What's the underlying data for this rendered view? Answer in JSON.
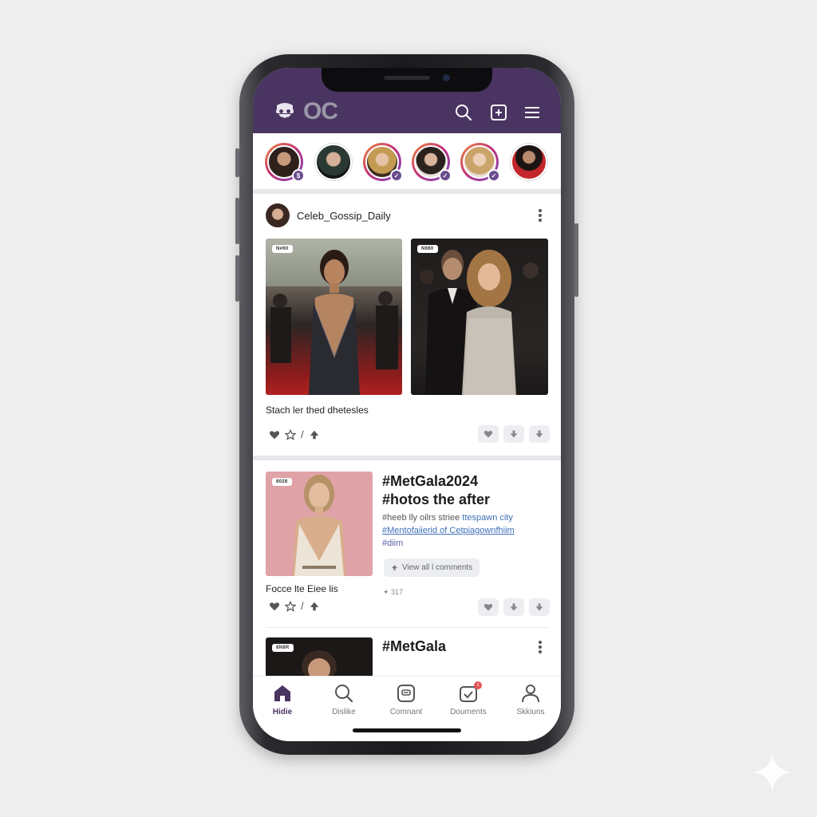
{
  "app": {
    "logo_text": "OC",
    "header_icons": [
      "search-icon",
      "add-post-icon",
      "menu-icon"
    ]
  },
  "stories": [
    {
      "badge": "$"
    },
    {
      "badge": ""
    },
    {
      "badge": "✓"
    },
    {
      "badge": "✓"
    },
    {
      "badge": "✓"
    },
    {
      "badge": ""
    }
  ],
  "post1": {
    "username": "Celeb_Gossip_Daily",
    "photo_tags": [
      "N#60",
      "N860"
    ],
    "caption": "Stach ler thed dhetesles",
    "react_separator": "/"
  },
  "post2": {
    "photo_tag": "8028",
    "headline_line1": "#MetGala2024",
    "headline_line2": "#hotos the after",
    "body_line1_plain": "#heeb lly oilrs striee ",
    "body_line1_link": "ttespawn city",
    "body_line2_link": "#Mentofaiierid of Cetpiagownfhiim",
    "body_line3_hash": "#diim",
    "comments_label": "View all l comments",
    "caption": "Focce lte Eiee lis",
    "meta": "317",
    "react_separator": "/"
  },
  "post3": {
    "photo_tag": "8N8R",
    "headline": "#MetGala"
  },
  "bottom_nav": [
    {
      "label": "Hidie",
      "icon": "home-icon",
      "active": true
    },
    {
      "label": "Dislike",
      "icon": "search-icon",
      "active": false
    },
    {
      "label": "Comnant",
      "icon": "comment-icon",
      "active": false
    },
    {
      "label": "Douments",
      "icon": "calendar-icon",
      "active": false,
      "badge": "1"
    },
    {
      "label": "Skkiuns",
      "icon": "profile-icon",
      "active": false
    }
  ],
  "colors": {
    "header": "#4a3461",
    "accent": "#6a4c8d",
    "link": "#3d6fb8",
    "background": "#eeeeee"
  }
}
